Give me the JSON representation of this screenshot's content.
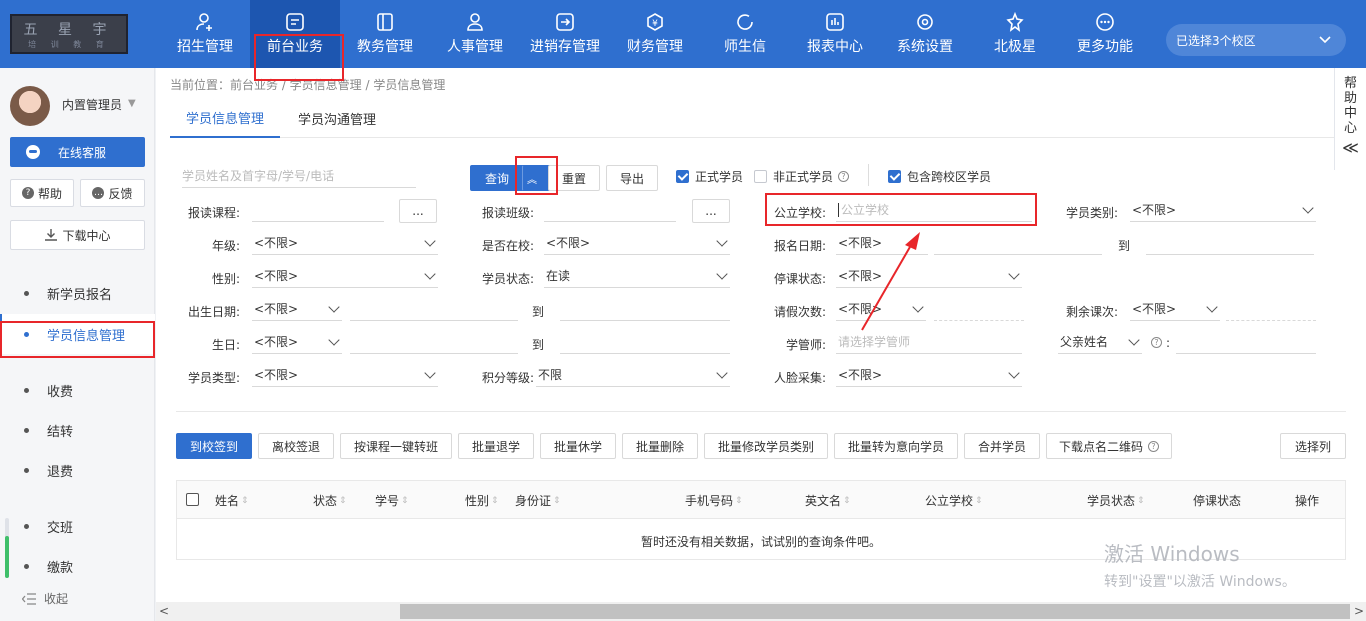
{
  "logo": {
    "line1": "五 星 宇",
    "line2": "培 训 教 育"
  },
  "topnav": {
    "items": [
      {
        "label": "招生管理",
        "icon": "user-plus-icon"
      },
      {
        "label": "前台业务",
        "icon": "desk-icon"
      },
      {
        "label": "教务管理",
        "icon": "book-icon"
      },
      {
        "label": "人事管理",
        "icon": "person-icon"
      },
      {
        "label": "进销存管理",
        "icon": "inventory-icon"
      },
      {
        "label": "财务管理",
        "icon": "finance-icon"
      },
      {
        "label": "师生信",
        "icon": "chat-icon"
      },
      {
        "label": "报表中心",
        "icon": "report-icon"
      },
      {
        "label": "系统设置",
        "icon": "settings-icon"
      },
      {
        "label": "北极星",
        "icon": "star-icon"
      },
      {
        "label": "更多功能",
        "icon": "more-icon"
      }
    ],
    "campus_select": "已选择3个校区"
  },
  "sidebar": {
    "username": "内置管理员",
    "customer_service": "在线客服",
    "help": "帮助",
    "feedback": "反馈",
    "download_center": "下载中心",
    "menu": [
      "新学员报名",
      "学员信息管理",
      "收费",
      "结转",
      "退费",
      "交班",
      "缴款"
    ],
    "collapse": "收起"
  },
  "breadcrumb": "当前位置：前台业务 / 学员信息管理 / 学员信息管理",
  "tabs": [
    "学员信息管理",
    "学员沟通管理"
  ],
  "help_center": [
    "帮",
    "助",
    "中",
    "心",
    "≪"
  ],
  "search": {
    "placeholder": "学员姓名及首字母/学号/电话",
    "query": "查询",
    "expand": "»",
    "reset": "重置",
    "export": "导出",
    "chk_formal": "正式学员",
    "chk_informal": "非正式学员",
    "chk_cross": "包含跨校区学员"
  },
  "filters": {
    "course_label": "报读课程:",
    "class_label": "报读班级:",
    "school_label": "公立学校:",
    "school_placeholder": "公立学校",
    "type_label": "学员类别:",
    "type_value": "<不限>",
    "grade_label": "年级:",
    "grade_value": "<不限>",
    "inschool_label": "是否在校:",
    "inschool_value": "<不限>",
    "signup_label": "报名日期:",
    "signup_value": "<不限>",
    "to": "到",
    "gender_label": "性别:",
    "gender_value": "<不限>",
    "status_label": "学员状态:",
    "status_value": "在读",
    "suspend_label": "停课状态:",
    "suspend_value": "<不限>",
    "birthdate_label": "出生日期:",
    "birthdate_value": "<不限>",
    "leave_label": "请假次数:",
    "leave_value": "<不限>",
    "remain_label": "剩余课次:",
    "remain_value": "<不限>",
    "birthday_label": "生日:",
    "birthday_value": "<不限>",
    "tutor_label": "学管师:",
    "tutor_placeholder": "请选择学管师",
    "father_value": "父亲姓名",
    "colon": ":",
    "stype_label": "学员类型:",
    "stype_value": "<不限>",
    "points_label": "积分等级:",
    "points_value": "不限",
    "face_label": "人脸采集:",
    "face_value": "<不限>"
  },
  "actions": [
    "到校签到",
    "离校签退",
    "按课程一键转班",
    "批量退学",
    "批量休学",
    "批量删除",
    "批量修改学员类别",
    "批量转为意向学员",
    "合并学员",
    "下载点名二维码",
    "选择列"
  ],
  "table": {
    "columns": [
      "姓名",
      "状态",
      "学号",
      "性别",
      "身份证",
      "手机号码",
      "英文名",
      "公立学校",
      "学员状态",
      "停课状态",
      "操作"
    ],
    "empty": "暂时还没有相关数据，试试别的查询条件吧。"
  },
  "watermark": {
    "line1": "激活 Windows",
    "line2": "转到\"设置\"以激活 Windows。"
  },
  "colors": {
    "primary": "#2f6fcf",
    "annotation": "#e8262a"
  }
}
